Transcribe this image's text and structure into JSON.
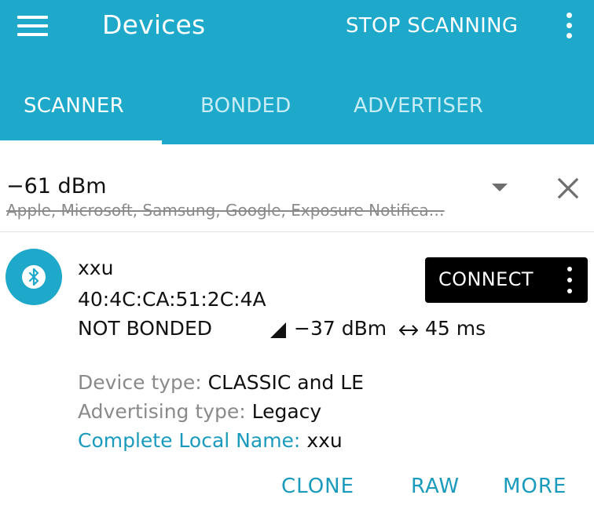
{
  "colors": {
    "app_bar": "#1ea8c9",
    "accent": "#1a9bbd",
    "connect_button": "#000000"
  },
  "header": {
    "title": "Devices",
    "stop_scanning_label": "STOP SCANNING",
    "menu_icon": "hamburger-menu-icon",
    "overflow_icon": "more-vertical-icon"
  },
  "tabs": [
    {
      "label": "SCANNER",
      "selected": true
    },
    {
      "label": "BONDED",
      "selected": false
    },
    {
      "label": "ADVERTISER",
      "selected": false
    }
  ],
  "filter": {
    "rssi": "−61 dBm",
    "excluded_names": "Apple, Microsoft, Samsung, Google, Exposure Notifica…",
    "dropdown_icon": "dropdown-arrow-icon",
    "clear_icon": "close-icon"
  },
  "device": {
    "icon": "bluetooth-icon",
    "name": "xxu",
    "address": "40:4C:CA:51:2C:4A",
    "bond_state": "NOT BONDED",
    "rssi": "−37 dBm",
    "interval": "45 ms",
    "connect_label": "CONNECT",
    "details": [
      {
        "key": "Device type:",
        "value": "CLASSIC and LE"
      },
      {
        "key": "Advertising type:",
        "value": "Legacy"
      },
      {
        "key": "Complete Local Name:",
        "value": "xxu"
      }
    ],
    "actions": {
      "clone": "CLONE",
      "raw": "RAW",
      "more": "MORE"
    }
  }
}
